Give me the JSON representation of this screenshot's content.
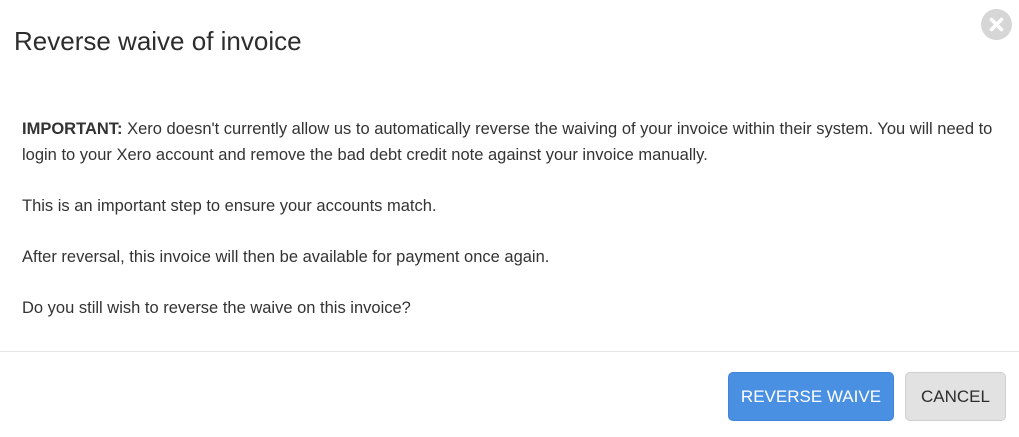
{
  "dialog": {
    "title": "Reverse waive of invoice",
    "close_icon": "close-icon"
  },
  "body": {
    "important_label": "IMPORTANT:",
    "important_text": " Xero doesn't currently allow us to automatically reverse the waiving of your invoice within their system. You will need to login to your Xero account and remove the bad debt credit note against your invoice manually.",
    "paragraph_2": "This is an important step to ensure your accounts match.",
    "paragraph_3": "After reversal, this invoice will then be available for payment once again.",
    "paragraph_4": "Do you still wish to reverse the waive on this invoice?"
  },
  "footer": {
    "confirm_label": "REVERSE WAIVE",
    "cancel_label": "CANCEL"
  },
  "colors": {
    "primary_button": "#4a90e2",
    "secondary_button": "#e2e2e2",
    "close_button": "#d6d6d6"
  }
}
